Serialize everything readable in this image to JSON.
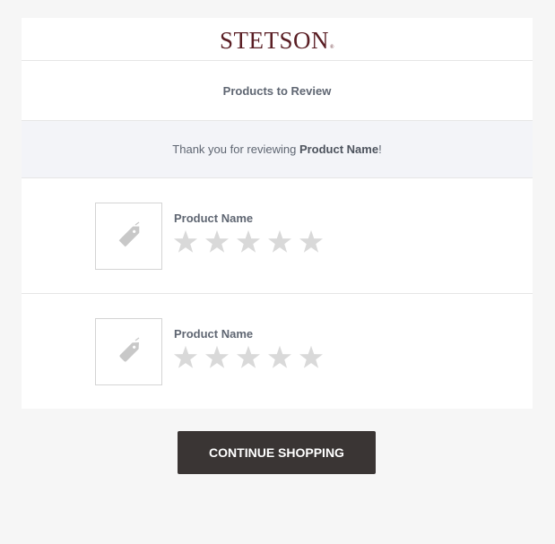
{
  "header": {
    "logo_text": "STETSON",
    "logo_mark": "®"
  },
  "section": {
    "title": "Products to Review"
  },
  "thanks": {
    "prefix": "Thank you for reviewing ",
    "product": "Product Name",
    "suffix": "!"
  },
  "products": [
    {
      "name": "Product Name",
      "thumb_icon": "tag-icon",
      "rating": 0,
      "max_rating": 5
    },
    {
      "name": "Product Name",
      "thumb_icon": "tag-icon",
      "rating": 0,
      "max_rating": 5
    }
  ],
  "cta": {
    "label": "CONTINUE SHOPPING"
  },
  "colors": {
    "brand": "#5a1e24",
    "button": "#3a3534",
    "star_empty": "#d9d9d9",
    "tag_icon": "#c8c8c8"
  }
}
